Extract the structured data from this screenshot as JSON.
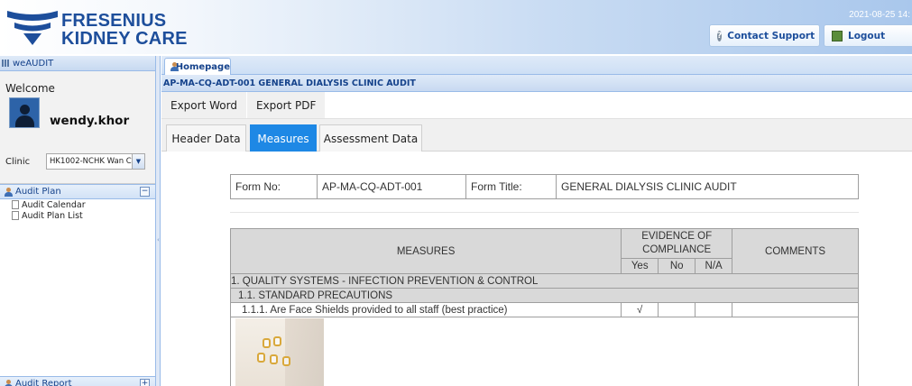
{
  "header": {
    "brand_line1": "FRESENIUS",
    "brand_line2": "KIDNEY CARE",
    "datetime": "2021-08-25 14:",
    "contact_support_label": "Contact Support",
    "logout_label": "Logout",
    "brand_color": "#1d4e9b"
  },
  "left_panel": {
    "title": "weAUDIT",
    "welcome": "Welcome",
    "username": "wendy.khor",
    "clinic_label": "Clinic",
    "clinic_value": "HK1002-NCHK Wan C",
    "audit_plan": {
      "label": "Audit Plan",
      "items": [
        "Audit Calendar",
        "Audit Plan List"
      ]
    },
    "audit_report_label": "Audit Report"
  },
  "main": {
    "home_tab": "Homepage",
    "page_title": "AP-MA-CQ-ADT-001 GENERAL DIALYSIS CLINIC AUDIT",
    "toolbar": {
      "export_word": "Export Word",
      "export_pdf": "Export PDF"
    },
    "tabs": [
      {
        "label": "Header Data",
        "active": false
      },
      {
        "label": "Measures",
        "active": true
      },
      {
        "label": "Assessment Data",
        "active": false
      }
    ],
    "accent_color": "#1e88e5",
    "form_info": {
      "form_no_label": "Form No:",
      "form_no_value": "AP-MA-CQ-ADT-001",
      "form_title_label": "Form Title:",
      "form_title_value": "GENERAL DIALYSIS CLINIC AUDIT"
    },
    "measures_table": {
      "col_measures": "MEASURES",
      "col_evidence": "EVIDENCE OF COMPLIANCE",
      "col_yes": "Yes",
      "col_no": "No",
      "col_na": "N/A",
      "col_comments": "COMMENTS",
      "section": "1. QUALITY SYSTEMS - INFECTION PREVENTION & CONTROL",
      "subsection": "1.1. STANDARD PRECAUTIONS",
      "question": "1.1.1. Are Face Shields provided to all staff (best practice)",
      "yes_mark": "√"
    }
  }
}
